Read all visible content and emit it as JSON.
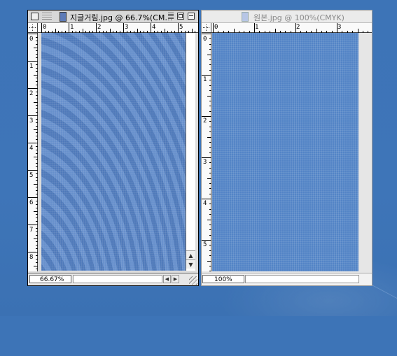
{
  "windows": [
    {
      "id": "moire",
      "title": "지글거림.jpg @ 66.7%(CM…",
      "active": true,
      "zoom_value": "66.67%",
      "ruler_h": [
        "0",
        "1",
        "2",
        "3",
        "4",
        "5"
      ],
      "ruler_v": [
        "0",
        "1",
        "2",
        "3",
        "4",
        "5",
        "6",
        "7",
        "8"
      ]
    },
    {
      "id": "original",
      "title": "원본.jpg @ 100%(CMYK)",
      "active": false,
      "zoom_value": "100%",
      "ruler_h": [
        "0",
        "1",
        "2",
        "3"
      ],
      "ruler_v": [
        "0",
        "1",
        "2",
        "3",
        "4",
        "5"
      ]
    }
  ],
  "colors": {
    "desktop": "#3e75b8",
    "canvas_moire": "#5a87c8",
    "canvas_original": "#5384c6"
  },
  "icons": [
    "close-box-icon",
    "window-menu-icon",
    "document-icon",
    "collapse-icon",
    "zoom-box-icon",
    "grip-icon",
    "arrow-up-icon",
    "arrow-down-icon",
    "arrow-left-icon",
    "arrow-right-icon",
    "resize-grip-icon"
  ]
}
